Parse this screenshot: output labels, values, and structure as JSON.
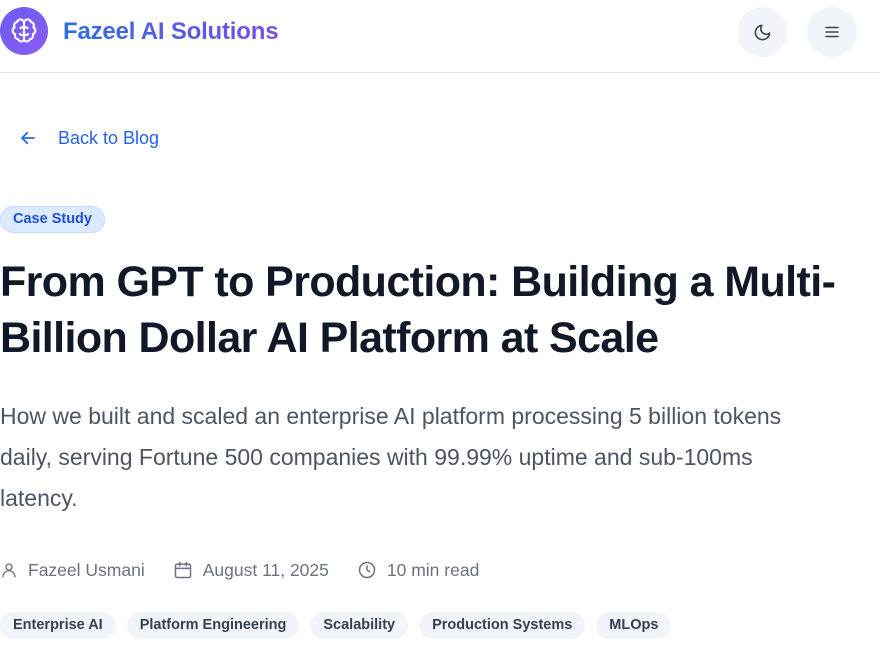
{
  "header": {
    "brand": "Fazeel AI Solutions",
    "logo_icon": "brain-icon",
    "theme_toggle_icon": "moon-icon",
    "menu_icon": "menu-icon"
  },
  "nav": {
    "back_label": "Back to Blog",
    "back_icon": "arrow-left-icon"
  },
  "article": {
    "category": "Case Study",
    "title": "From GPT to Production: Building a Multi-Billion Dollar AI Platform at Scale",
    "summary": "How we built and scaled an enterprise AI platform processing 5 billion tokens daily, serving Fortune 500 companies with 99.99% uptime and sub-100ms latency.",
    "author": "Fazeel Usmani",
    "date": "August 11, 2025",
    "read_time": "10 min read",
    "tags": [
      "Enterprise AI",
      "Platform Engineering",
      "Scalability",
      "Production Systems",
      "MLOps"
    ]
  },
  "colors": {
    "accent": "#2563eb",
    "brand_gradient_start": "#2f6fe0",
    "brand_gradient_end": "#7c4ddf",
    "badge_bg": "#dbeafe",
    "tag_bg": "#f1f5f9"
  }
}
